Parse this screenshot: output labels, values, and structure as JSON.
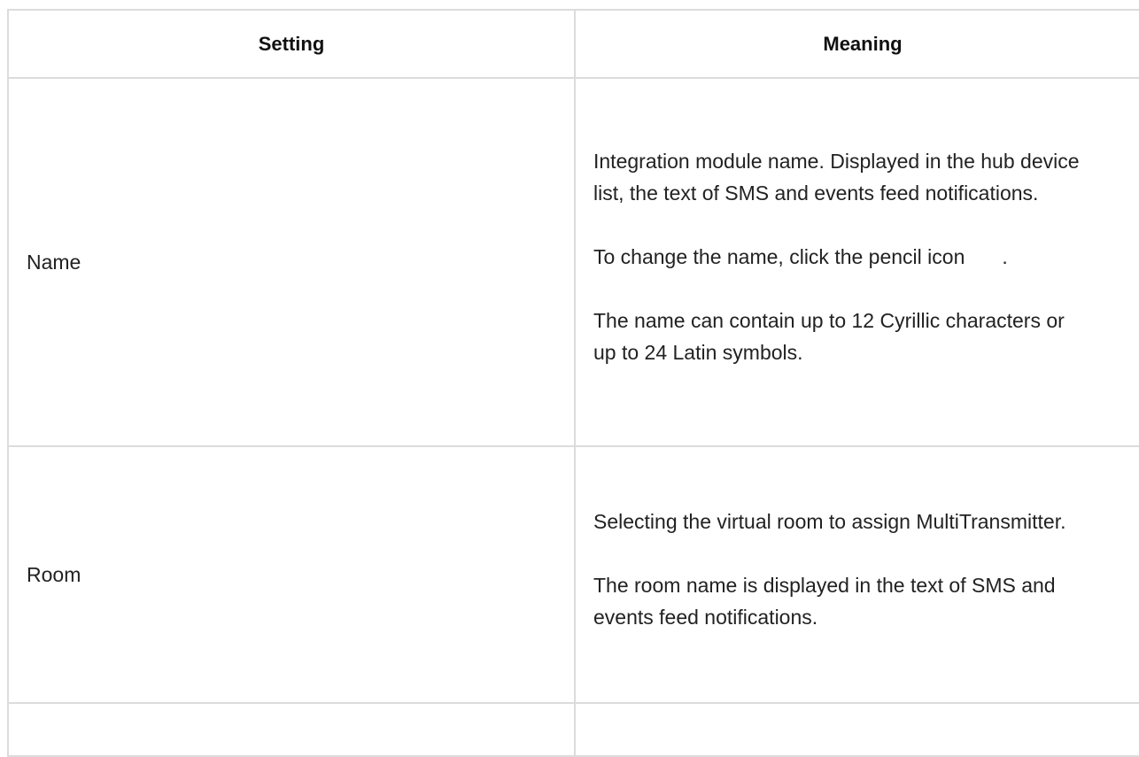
{
  "table": {
    "headers": {
      "setting": "Setting",
      "meaning": "Meaning"
    },
    "rows": [
      {
        "setting": "Name",
        "meaning": [
          "Integration module name. Displayed in the hub device list, the text of SMS and events feed notifications.",
          "To change the name, click the pencil icon",
          "The name can contain up to 12 Cyrillic characters or up to 24 Latin symbols."
        ],
        "meaning_suffix": "."
      },
      {
        "setting": "Room",
        "meaning": [
          "Selecting the virtual room to assign MultiTransmitter.",
          "The room name is displayed in the text of SMS and events feed notifications."
        ]
      }
    ]
  }
}
